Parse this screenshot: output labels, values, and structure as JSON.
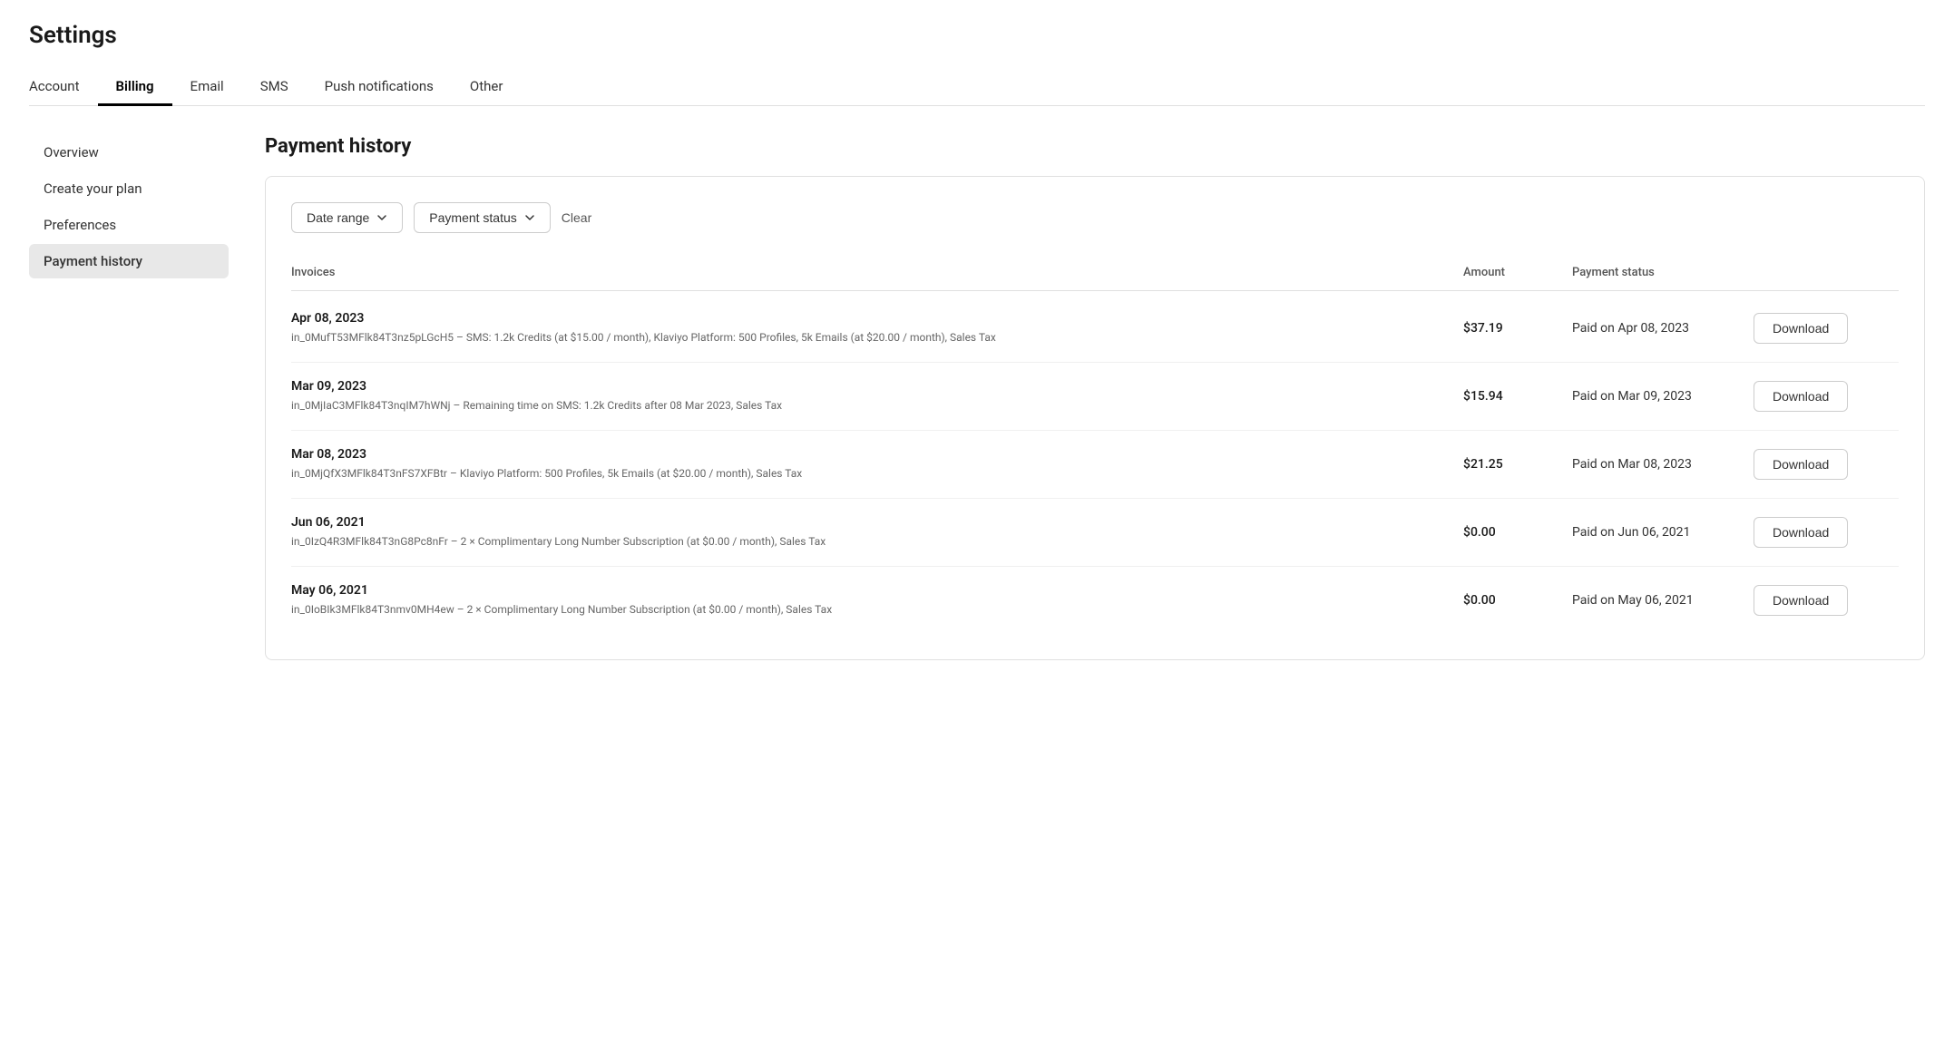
{
  "page": {
    "title": "Settings"
  },
  "topnav": {
    "items": [
      {
        "label": "Account",
        "active": false
      },
      {
        "label": "Billing",
        "active": true
      },
      {
        "label": "Email",
        "active": false
      },
      {
        "label": "SMS",
        "active": false
      },
      {
        "label": "Push notifications",
        "active": false
      },
      {
        "label": "Other",
        "active": false
      }
    ]
  },
  "sidebar": {
    "items": [
      {
        "label": "Overview",
        "active": false
      },
      {
        "label": "Create your plan",
        "active": false
      },
      {
        "label": "Preferences",
        "active": false
      },
      {
        "label": "Payment history",
        "active": true
      }
    ]
  },
  "main": {
    "section_title": "Payment history",
    "filters": {
      "date_range_label": "Date range",
      "payment_status_label": "Payment status",
      "clear_label": "Clear"
    },
    "table": {
      "columns": [
        "Invoices",
        "Amount",
        "Payment status",
        ""
      ],
      "rows": [
        {
          "date": "Apr 08, 2023",
          "description": "in_0MufT53MFlk84T3nz5pLGcH5 – SMS: 1.2k Credits (at $15.00 / month), Klaviyo Platform: 500 Profiles, 5k Emails (at $20.00 / month), Sales Tax",
          "amount": "$37.19",
          "payment_status": "Paid on Apr 08, 2023",
          "download_label": "Download"
        },
        {
          "date": "Mar 09, 2023",
          "description": "in_0MjIaC3MFlk84T3nqIM7hWNj – Remaining time on SMS: 1.2k Credits after 08 Mar 2023, Sales Tax",
          "amount": "$15.94",
          "payment_status": "Paid on Mar 09, 2023",
          "download_label": "Download"
        },
        {
          "date": "Mar 08, 2023",
          "description": "in_0MjQfX3MFlk84T3nFS7XFBtr – Klaviyo Platform: 500 Profiles, 5k Emails (at $20.00 / month), Sales Tax",
          "amount": "$21.25",
          "payment_status": "Paid on Mar 08, 2023",
          "download_label": "Download"
        },
        {
          "date": "Jun 06, 2021",
          "description": "in_0IzQ4R3MFlk84T3nG8Pc8nFr – 2 × Complimentary Long Number Subscription (at $0.00 / month), Sales Tax",
          "amount": "$0.00",
          "payment_status": "Paid on Jun 06, 2021",
          "download_label": "Download"
        },
        {
          "date": "May 06, 2021",
          "description": "in_0IoBIk3MFlk84T3nmv0MH4ew – 2 × Complimentary Long Number Subscription (at $0.00 / month), Sales Tax",
          "amount": "$0.00",
          "payment_status": "Paid on May 06, 2021",
          "download_label": "Download"
        }
      ]
    }
  }
}
